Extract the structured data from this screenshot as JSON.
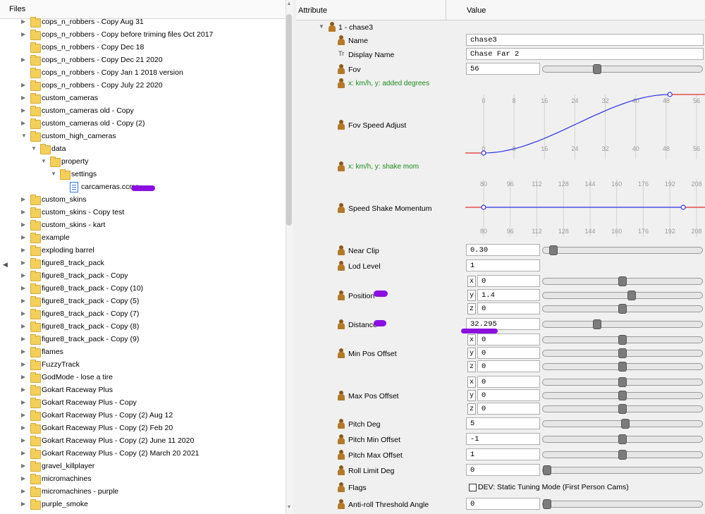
{
  "files_panel": {
    "header": "Files",
    "items": [
      {
        "label": "cops_n_robbers - Copy Aug 31",
        "icon": "folder-icon",
        "level": 2,
        "expander": "collapsed"
      },
      {
        "label": "cops_n_robbers - Copy before triming files Oct 2017",
        "icon": "folder-icon",
        "level": 2,
        "expander": "collapsed"
      },
      {
        "label": "cops_n_robbers - Copy Dec 18",
        "icon": "folder-icon",
        "level": 2,
        "expander": "none"
      },
      {
        "label": "cops_n_robbers - Copy Dec 21 2020",
        "icon": "folder-icon",
        "level": 2,
        "expander": "collapsed"
      },
      {
        "label": "cops_n_robbers - Copy Jan 1 2018 version",
        "icon": "folder-icon",
        "level": 2,
        "expander": "none"
      },
      {
        "label": "cops_n_robbers - Copy July 22  2020",
        "icon": "folder-icon",
        "level": 2,
        "expander": "collapsed"
      },
      {
        "label": "custom_cameras",
        "icon": "folder-icon",
        "level": 2,
        "expander": "collapsed"
      },
      {
        "label": "custom_cameras old - Copy",
        "icon": "folder-icon",
        "level": 2,
        "expander": "collapsed"
      },
      {
        "label": "custom_cameras old - Copy (2)",
        "icon": "folder-icon",
        "level": 2,
        "expander": "collapsed"
      },
      {
        "label": "custom_high_cameras",
        "icon": "folder-icon",
        "level": 2,
        "expander": "expanded"
      },
      {
        "label": "data",
        "icon": "folder-icon",
        "level": 3,
        "expander": "expanded"
      },
      {
        "label": "property",
        "icon": "folder-icon",
        "level": 4,
        "expander": "expanded"
      },
      {
        "label": "settings",
        "icon": "folder-icon",
        "level": 5,
        "expander": "expanded"
      },
      {
        "label": "carcameras.ccms",
        "icon": "file-icon",
        "level": 6,
        "expander": "none"
      },
      {
        "label": "custom_skins",
        "icon": "folder-icon",
        "level": 2,
        "expander": "collapsed"
      },
      {
        "label": "custom_skins - Copy test",
        "icon": "folder-icon",
        "level": 2,
        "expander": "collapsed"
      },
      {
        "label": "custom_skins - kart",
        "icon": "folder-icon",
        "level": 2,
        "expander": "collapsed"
      },
      {
        "label": "example",
        "icon": "folder-icon",
        "level": 2,
        "expander": "collapsed"
      },
      {
        "label": "exploding barrel",
        "icon": "folder-icon",
        "level": 2,
        "expander": "collapsed"
      },
      {
        "label": "figure8_track_pack",
        "icon": "folder-icon",
        "level": 2,
        "expander": "collapsed"
      },
      {
        "label": "figure8_track_pack - Copy",
        "icon": "folder-icon",
        "level": 2,
        "expander": "collapsed"
      },
      {
        "label": "figure8_track_pack - Copy (10)",
        "icon": "folder-icon",
        "level": 2,
        "expander": "collapsed"
      },
      {
        "label": "figure8_track_pack - Copy (5)",
        "icon": "folder-icon",
        "level": 2,
        "expander": "collapsed"
      },
      {
        "label": "figure8_track_pack - Copy (7)",
        "icon": "folder-icon",
        "level": 2,
        "expander": "collapsed"
      },
      {
        "label": "figure8_track_pack - Copy (8)",
        "icon": "folder-icon",
        "level": 2,
        "expander": "collapsed"
      },
      {
        "label": "figure8_track_pack - Copy (9)",
        "icon": "folder-icon",
        "level": 2,
        "expander": "collapsed"
      },
      {
        "label": "flames",
        "icon": "folder-icon",
        "level": 2,
        "expander": "collapsed"
      },
      {
        "label": "FuzzyTrack",
        "icon": "folder-icon",
        "level": 2,
        "expander": "collapsed"
      },
      {
        "label": "GodMode - lose a tire",
        "icon": "folder-icon",
        "level": 2,
        "expander": "collapsed"
      },
      {
        "label": "Gokart Raceway Plus",
        "icon": "folder-icon",
        "level": 2,
        "expander": "collapsed"
      },
      {
        "label": "Gokart Raceway Plus - Copy",
        "icon": "folder-icon",
        "level": 2,
        "expander": "collapsed"
      },
      {
        "label": "Gokart Raceway Plus - Copy (2) Aug 12",
        "icon": "folder-icon",
        "level": 2,
        "expander": "collapsed"
      },
      {
        "label": "Gokart Raceway Plus - Copy (2) Feb 20",
        "icon": "folder-icon",
        "level": 2,
        "expander": "collapsed"
      },
      {
        "label": "Gokart Raceway Plus - Copy (2) June 11 2020",
        "icon": "folder-icon",
        "level": 2,
        "expander": "collapsed"
      },
      {
        "label": "Gokart Raceway Plus - Copy (2) March 20 2021",
        "icon": "folder-icon",
        "level": 2,
        "expander": "collapsed"
      },
      {
        "label": "gravel_killplayer",
        "icon": "folder-icon",
        "level": 2,
        "expander": "collapsed"
      },
      {
        "label": "micromachines",
        "icon": "folder-icon",
        "level": 2,
        "expander": "collapsed"
      },
      {
        "label": "micromachines - purple",
        "icon": "folder-icon",
        "level": 2,
        "expander": "collapsed"
      },
      {
        "label": "purple_smoke",
        "icon": "folder-icon",
        "level": 2,
        "expander": "collapsed"
      }
    ]
  },
  "properties_panel": {
    "header_attribute": "Attribute",
    "header_value": "Value",
    "root_node": "1 - chase3",
    "name": {
      "label": "Name",
      "value": "chase3"
    },
    "display_name": {
      "label": "Display Name",
      "value": "Chase Far 2",
      "icon_text": "Tr"
    },
    "fov": {
      "label": "Fov",
      "value": "56",
      "slider_level": 0.33
    },
    "fov_curve_hint": "x: km/h, y: added degrees",
    "fov_speed_adjust": {
      "label": "Fov Speed Adjust"
    },
    "shake_curve_hint": "x: km/h, y: shake mom",
    "speed_shake_momentum": {
      "label": "Speed Shake Momentum"
    },
    "near_clip": {
      "label": "Near Clip",
      "value": "0.30",
      "slider_level": 0.04
    },
    "lod_level": {
      "label": "Lod Level",
      "value": "1"
    },
    "position": {
      "label": "Position",
      "x": "0",
      "y": "1.4",
      "z": "0",
      "x_level": 0.5,
      "y_level": 0.56,
      "z_level": 0.5
    },
    "distance": {
      "label": "Distance",
      "value": "32.295",
      "slider_level": 0.33
    },
    "min_pos_offset": {
      "label": "Min Pos Offset",
      "x": "0",
      "y": "0",
      "z": "0",
      "x_level": 0.5,
      "y_level": 0.5,
      "z_level": 0.5
    },
    "max_pos_offset": {
      "label": "Max Pos Offset",
      "x": "0",
      "y": "0",
      "z": "0",
      "x_level": 0.5,
      "y_level": 0.5,
      "z_level": 0.5
    },
    "pitch_deg": {
      "label": "Pitch Deg",
      "value": "5",
      "slider_level": 0.52
    },
    "pitch_min_offset": {
      "label": "Pitch Min Offset",
      "value": "-1",
      "slider_level": 0.5
    },
    "pitch_max_offset": {
      "label": "Pitch Max Offset",
      "value": "1",
      "slider_level": 0.5
    },
    "roll_limit_deg": {
      "label": "Roll Limit Deg",
      "value": "0",
      "slider_level": 0.0
    },
    "flags": {
      "label": "Flags",
      "checkbox_label": "DEV: Static Tuning Mode (First Person Cams)",
      "checked": false
    },
    "anti_roll": {
      "label": "Anti-roll Threshold Angle",
      "value": "0",
      "slider_level": 0.0
    },
    "axis_labels": {
      "x_axis_letter": "x",
      "y_axis_letter": "y",
      "z_axis_letter": "z"
    }
  },
  "chart_data": [
    {
      "type": "line",
      "x_ticks": [
        "0",
        "8",
        "16",
        "24",
        "32",
        "40",
        "48",
        "56"
      ],
      "points": [
        [
          0,
          0
        ],
        [
          49,
          1
        ]
      ],
      "curve": "smoothstep",
      "color": "#2f2fe0",
      "clamp_color": "#e03030"
    },
    {
      "type": "line",
      "x_ticks": [
        "80",
        "96",
        "112",
        "128",
        "144",
        "160",
        "176",
        "192",
        "208"
      ],
      "points": [
        [
          80,
          0
        ],
        [
          200,
          0
        ]
      ],
      "curve": "linear",
      "color": "#2f2fe0",
      "clamp_color": "#e03030"
    }
  ],
  "colors": {
    "accent_marker": "#8b10e0",
    "hint_green": "#1c8a1c"
  }
}
